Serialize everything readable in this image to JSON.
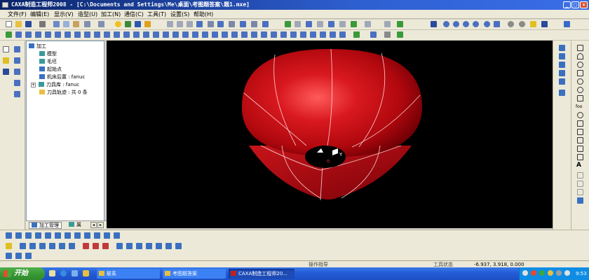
{
  "window": {
    "title": "CAXA制造工程师2008  - [C:\\Documents and Settings\\Me\\桌面\\考图题答案\\题1.mxe]",
    "minimize_glyph": "_",
    "maximize_glyph": "□",
    "close_glyph": "×"
  },
  "menu": [
    "文件(F)",
    "编辑(E)",
    "显示(V)",
    "造型(U)",
    "加工(N)",
    "通信(C)",
    "工具(T)",
    "设置(S)",
    "帮助(H)"
  ],
  "tree": {
    "root": "加工",
    "items": [
      "模型",
      "毛坯",
      "起始点",
      "机床后置 : fanuc",
      "刀具库 : fanuc",
      "刀具轨迹 : 共 0 条"
    ],
    "tabs": [
      "加工管理",
      "属"
    ]
  },
  "viewport": {
    "background": "#000000",
    "surface_color": "#c8141a",
    "axis_label_y": "Y",
    "axis_label_origin": "o"
  },
  "statusbar": {
    "prompt": "操作指导",
    "state": "工具状态",
    "coords": "-6.937, 3.918, 0.000"
  },
  "taskbar": {
    "start": "开始",
    "tasks": [
      "联系",
      "考图题答案",
      "CAXA制造工程师20..."
    ],
    "clock": "9:53"
  },
  "icons": {
    "toolbar": [
      "new-file-icon",
      "open-file-icon",
      "save-icon",
      "print-icon",
      "cut-icon",
      "copy-icon",
      "paste-icon",
      "undo-icon",
      "redo-icon",
      "zoom-icon",
      "pan-icon",
      "rotate-icon"
    ],
    "left": [
      "select-arrow-icon",
      "curve-edit-icon",
      "view-icon"
    ],
    "right": [
      "line-icon",
      "arc-icon",
      "circle-icon",
      "rectangle-icon",
      "text-icon"
    ]
  }
}
